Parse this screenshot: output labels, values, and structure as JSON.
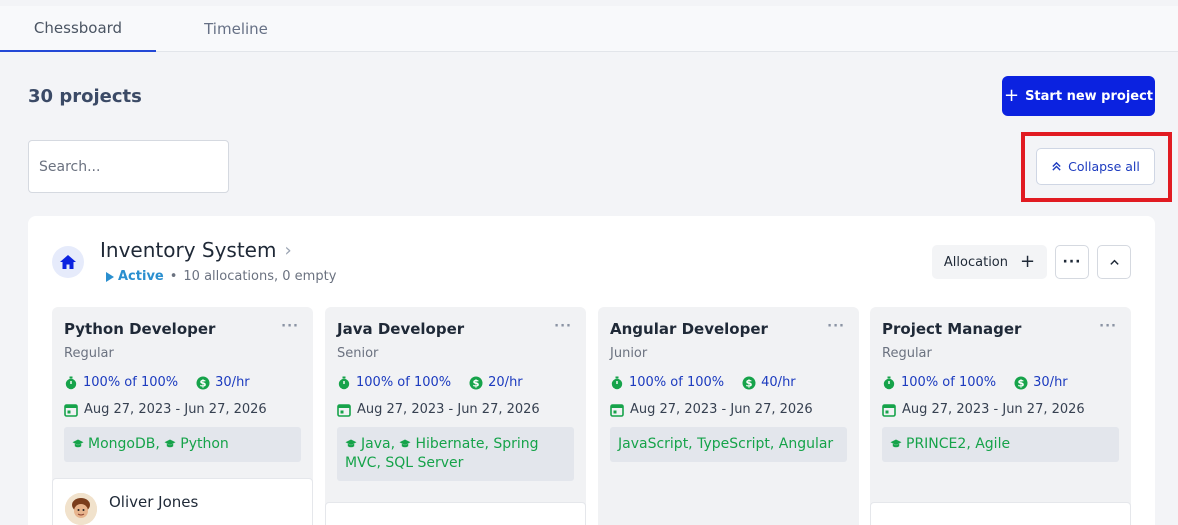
{
  "tabs": [
    {
      "label": "Chessboard"
    },
    {
      "label": "Timeline"
    }
  ],
  "header": {
    "project_count": "30 projects",
    "start_button": "Start new project"
  },
  "search": {
    "placeholder": "Search..."
  },
  "collapse_button": "Collapse all",
  "project": {
    "title": "Inventory System",
    "status": "Active",
    "separator": "•",
    "summary": "10 allocations, 0 empty",
    "allocation_button": "Allocation"
  },
  "cards": [
    {
      "role": "Python Developer",
      "level": "Regular",
      "allocation": "100% of 100%",
      "rate": "30/hr",
      "dates": "Aug 27, 2023 - Jun 27, 2026",
      "skills": [
        "MongoDB",
        "Python"
      ],
      "person": "Oliver Jones"
    },
    {
      "role": "Java Developer",
      "level": "Senior",
      "allocation": "100% of 100%",
      "rate": "20/hr",
      "dates": "Aug 27, 2023 - Jun 27, 2026",
      "skills": [
        "Java",
        "Hibernate",
        "Spring MVC",
        "SQL Server"
      ]
    },
    {
      "role": "Angular Developer",
      "level": "Junior",
      "allocation": "100% of 100%",
      "rate": "40/hr",
      "dates": "Aug 27, 2023 - Jun 27, 2026",
      "skills_text": "JavaScript, TypeScript, Angular"
    },
    {
      "role": "Project Manager",
      "level": "Regular",
      "allocation": "100% of 100%",
      "rate": "30/hr",
      "dates": "Aug 27, 2023 - Jun 27, 2026",
      "skills": [
        "PRINCE2",
        "Agile"
      ]
    }
  ],
  "colors": {
    "primary": "#0b22e0",
    "link": "#1c3bbf",
    "success": "#16a34a",
    "active": "#2a8fcf",
    "highlight": "#e11b22"
  },
  "icons": [
    "home-icon",
    "chevron-right-icon",
    "play-icon",
    "plus-icon",
    "more-icon",
    "chevron-up-icon",
    "double-chevron-up-icon",
    "stopwatch-icon",
    "dollar-icon",
    "calendar-icon",
    "graduation-cap-icon"
  ]
}
